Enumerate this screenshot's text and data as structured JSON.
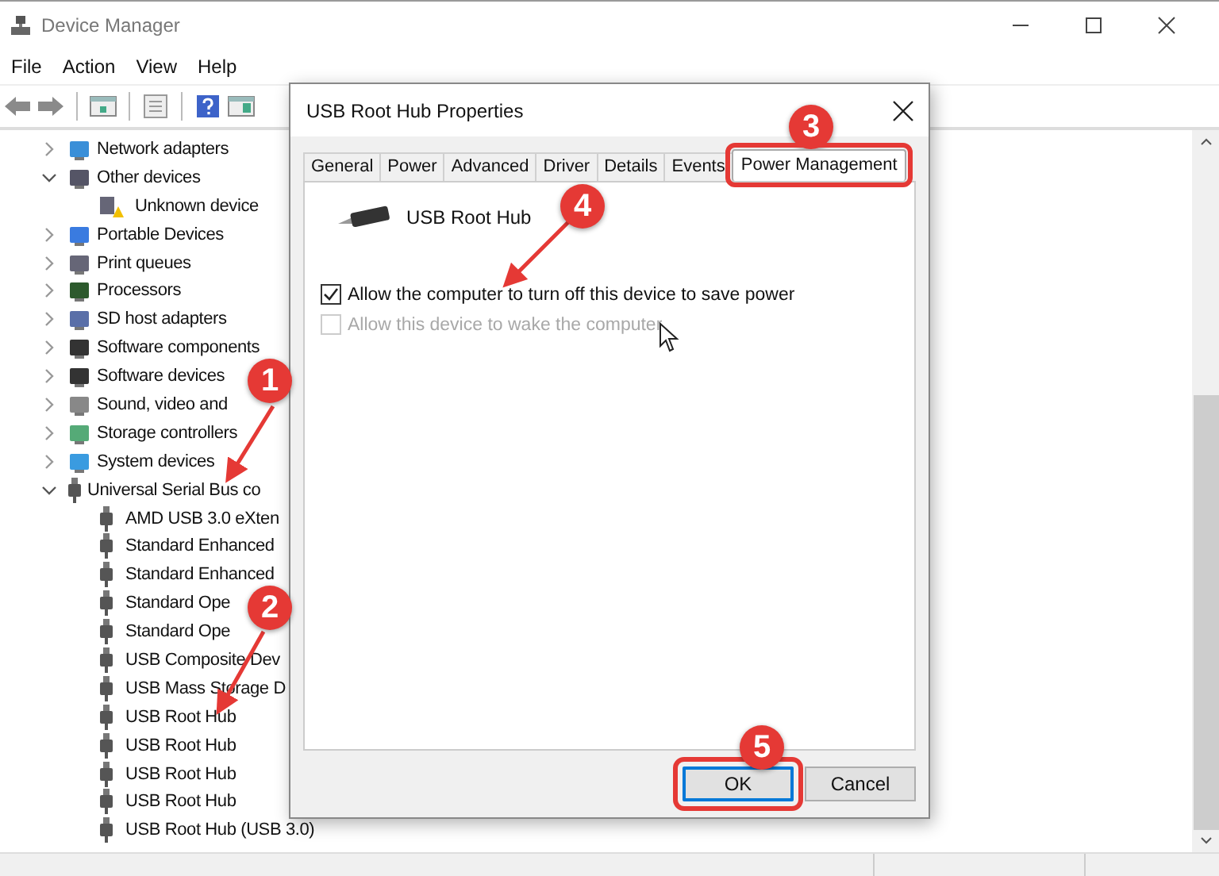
{
  "window": {
    "title": "Device Manager"
  },
  "menu": [
    "File",
    "Action",
    "View",
    "Help"
  ],
  "tree": [
    {
      "label": "Network adapters",
      "expanded": false
    },
    {
      "label": "Other devices",
      "expanded": true,
      "children": [
        {
          "label": "Unknown device"
        }
      ]
    },
    {
      "label": "Portable Devices",
      "expanded": false
    },
    {
      "label": "Print queues",
      "expanded": false
    },
    {
      "label": "Processors",
      "expanded": false
    },
    {
      "label": "SD host adapters",
      "expanded": false
    },
    {
      "label": "Software components",
      "expanded": false
    },
    {
      "label": "Software devices",
      "expanded": false
    },
    {
      "label": "Sound, video and",
      "expanded": false
    },
    {
      "label": "Storage controllers",
      "expanded": false
    },
    {
      "label": "System devices",
      "expanded": false
    },
    {
      "label": "Universal Serial Bus co",
      "expanded": true,
      "children": [
        {
          "label": "AMD USB 3.0 eXten"
        },
        {
          "label": "Standard Enhanced"
        },
        {
          "label": "Standard Enhanced"
        },
        {
          "label": "Standard Ope"
        },
        {
          "label": "Standard Ope"
        },
        {
          "label": "USB Composite Dev"
        },
        {
          "label": "USB Mass Storage D"
        },
        {
          "label": "USB Root Hub"
        },
        {
          "label": "USB Root Hub"
        },
        {
          "label": "USB Root Hub"
        },
        {
          "label": "USB Root Hub"
        },
        {
          "label": "USB Root Hub (USB 3.0)"
        }
      ]
    }
  ],
  "dialog": {
    "title": "USB Root Hub Properties",
    "tabs": [
      {
        "label": "General",
        "selected": false,
        "highlighted": false
      },
      {
        "label": "Power",
        "selected": false,
        "highlighted": false
      },
      {
        "label": "Advanced",
        "selected": false,
        "highlighted": false
      },
      {
        "label": "Driver",
        "selected": false,
        "highlighted": false
      },
      {
        "label": "Details",
        "selected": false,
        "highlighted": false
      },
      {
        "label": "Events",
        "selected": false,
        "highlighted": false
      },
      {
        "label": "Power Management",
        "selected": true,
        "highlighted": true
      }
    ],
    "device_name": "USB Root Hub",
    "options": [
      {
        "label": "Allow the computer to turn off this device to save power",
        "checked": true,
        "disabled": false
      },
      {
        "label": "Allow this device to wake the computer",
        "checked": false,
        "disabled": true
      }
    ],
    "buttons": [
      {
        "label": "OK",
        "default": true,
        "highlighted": true
      },
      {
        "label": "Cancel",
        "default": false,
        "highlighted": false
      }
    ]
  },
  "annotations": [
    {
      "label": "1"
    },
    {
      "label": "2"
    },
    {
      "label": "3"
    },
    {
      "label": "4"
    },
    {
      "label": "5"
    }
  ]
}
